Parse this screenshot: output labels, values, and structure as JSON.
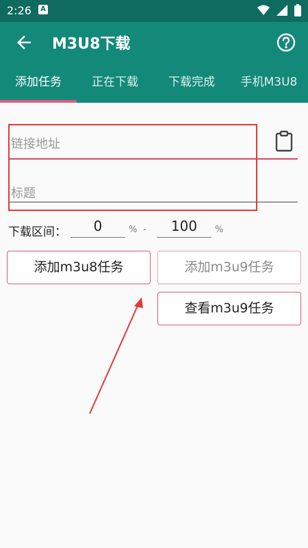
{
  "status_bar": {
    "time": "2:26",
    "app_badge": "A",
    "icons": [
      "wifi-icon",
      "signal-icon",
      "battery-icon"
    ]
  },
  "app_bar": {
    "title": "M3U8下载",
    "back_icon": "back-arrow-icon",
    "help_icon": "help-circle-icon",
    "color": "#13897a"
  },
  "tabs": [
    {
      "label": "添加任务",
      "active": true
    },
    {
      "label": "正在下载",
      "active": false
    },
    {
      "label": "下载完成",
      "active": false
    },
    {
      "label": "手机M3U8",
      "active": false
    }
  ],
  "form": {
    "url_placeholder": "链接地址",
    "title_placeholder": "标题",
    "clipboard_icon": "clipboard-icon",
    "range_label": "下载区间：",
    "range_start": "0",
    "range_end": "100",
    "percent_symbol": "%",
    "range_separator": "-"
  },
  "buttons": {
    "add_m3u8": "添加m3u8任务",
    "add_m3u9": "添加m3u9任务",
    "view_m3u9": "查看m3u9任务"
  },
  "colors": {
    "accent": "#e15c7a",
    "highlight_box": "#e53935"
  }
}
